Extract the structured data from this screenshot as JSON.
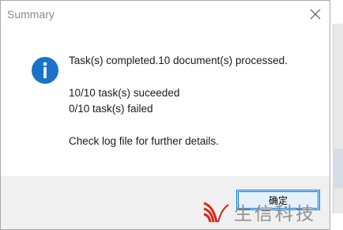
{
  "dialog": {
    "title": "Summary",
    "icon": "info-icon",
    "messages": {
      "line1": "Task(s) completed.10 document(s) processed.",
      "line2": "10/10 task(s) suceeded",
      "line3": "0/10 task(s) failed",
      "line4": "Check log file for further details."
    },
    "ok_label": "确定"
  },
  "watermark": {
    "text": "生信科技"
  },
  "colors": {
    "info_icon": "#1a73c9",
    "button_border": "#0078d7",
    "button_bg": "#e5f1fb",
    "footer_bg": "#f0f0f0",
    "watermark_red": "#d9261c"
  }
}
